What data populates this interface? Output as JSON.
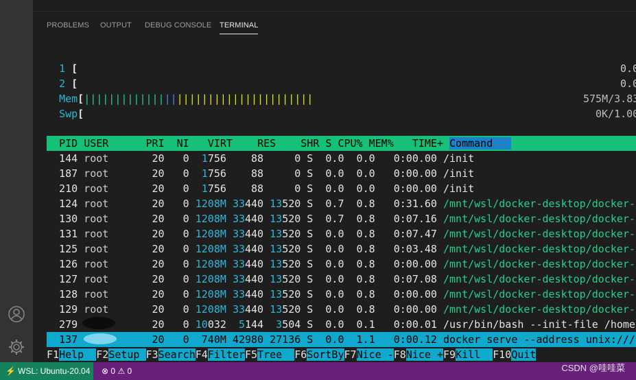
{
  "panel": {
    "tabs": [
      {
        "label": "PROBLEMS",
        "active": false
      },
      {
        "label": "OUTPUT",
        "active": false
      },
      {
        "label": "DEBUG CONSOLE",
        "active": false
      },
      {
        "label": "TERMINAL",
        "active": true
      }
    ]
  },
  "htop": {
    "meters": {
      "cpu1": {
        "label": "1",
        "bracket": "[",
        "value": "0.0"
      },
      "cpu2": {
        "label": "2",
        "bracket": "[",
        "value": "0.0"
      },
      "mem": {
        "label": "Mem",
        "bracket": "[",
        "bar_green": "|||||||||||||",
        "bar_blue": "||",
        "bar_yellow": "||||||||||||||||||||||",
        "value": "575M/3.83"
      },
      "swp": {
        "label": "Swp",
        "bracket": "[",
        "value": "0K/1.00"
      }
    },
    "columns": [
      "PID",
      "USER",
      "PRI",
      "NI",
      "VIRT",
      "RES",
      "SHR",
      "S",
      "CPU%",
      "MEM%",
      "TIME+",
      "Command"
    ],
    "sorted_column": "Command",
    "processes": [
      {
        "pid": "144",
        "user": "root",
        "pri": "20",
        "ni": "0",
        "virt": "1756",
        "res": "88",
        "shr": "0",
        "s": "S",
        "cpu": "0.0",
        "mem": "0.0",
        "time": "0:00.00",
        "command": "/init"
      },
      {
        "pid": "187",
        "user": "root",
        "pri": "20",
        "ni": "0",
        "virt": "1756",
        "res": "88",
        "shr": "0",
        "s": "S",
        "cpu": "0.0",
        "mem": "0.0",
        "time": "0:00.00",
        "command": "/init"
      },
      {
        "pid": "210",
        "user": "root",
        "pri": "20",
        "ni": "0",
        "virt": "1756",
        "res": "88",
        "shr": "0",
        "s": "S",
        "cpu": "0.0",
        "mem": "0.0",
        "time": "0:00.00",
        "command": "/init"
      },
      {
        "pid": "124",
        "user": "root",
        "pri": "20",
        "ni": "0",
        "virt": "1208M",
        "res": "33440",
        "shr": "13520",
        "s": "S",
        "cpu": "0.7",
        "mem": "0.8",
        "time": "0:31.60",
        "command": "/mnt/wsl/docker-desktop/docker-de"
      },
      {
        "pid": "130",
        "user": "root",
        "pri": "20",
        "ni": "0",
        "virt": "1208M",
        "res": "33440",
        "shr": "13520",
        "s": "S",
        "cpu": "0.7",
        "mem": "0.8",
        "time": "0:07.16",
        "command": "/mnt/wsl/docker-desktop/docker-de"
      },
      {
        "pid": "131",
        "user": "root",
        "pri": "20",
        "ni": "0",
        "virt": "1208M",
        "res": "33440",
        "shr": "13520",
        "s": "S",
        "cpu": "0.0",
        "mem": "0.8",
        "time": "0:07.47",
        "command": "/mnt/wsl/docker-desktop/docker-de"
      },
      {
        "pid": "125",
        "user": "root",
        "pri": "20",
        "ni": "0",
        "virt": "1208M",
        "res": "33440",
        "shr": "13520",
        "s": "S",
        "cpu": "0.0",
        "mem": "0.8",
        "time": "0:03.48",
        "command": "/mnt/wsl/docker-desktop/docker-de"
      },
      {
        "pid": "126",
        "user": "root",
        "pri": "20",
        "ni": "0",
        "virt": "1208M",
        "res": "33440",
        "shr": "13520",
        "s": "S",
        "cpu": "0.0",
        "mem": "0.8",
        "time": "0:00.00",
        "command": "/mnt/wsl/docker-desktop/docker-de"
      },
      {
        "pid": "127",
        "user": "root",
        "pri": "20",
        "ni": "0",
        "virt": "1208M",
        "res": "33440",
        "shr": "13520",
        "s": "S",
        "cpu": "0.0",
        "mem": "0.8",
        "time": "0:07.08",
        "command": "/mnt/wsl/docker-desktop/docker-de"
      },
      {
        "pid": "128",
        "user": "root",
        "pri": "20",
        "ni": "0",
        "virt": "1208M",
        "res": "33440",
        "shr": "13520",
        "s": "S",
        "cpu": "0.0",
        "mem": "0.8",
        "time": "0:00.00",
        "command": "/mnt/wsl/docker-desktop/docker-de"
      },
      {
        "pid": "129",
        "user": "root",
        "pri": "20",
        "ni": "0",
        "virt": "1208M",
        "res": "33440",
        "shr": "13520",
        "s": "S",
        "cpu": "0.0",
        "mem": "0.8",
        "time": "0:00.00",
        "command": "/mnt/wsl/docker-desktop/docker-de"
      },
      {
        "pid": "279",
        "user": "",
        "pri": "20",
        "ni": "0",
        "virt": "10032",
        "res": "5144",
        "shr": "3504",
        "s": "S",
        "cpu": "0.0",
        "mem": "0.1",
        "time": "0:00.01",
        "command": "/usr/bin/bash --init-file /home/c"
      }
    ],
    "selected_process": {
      "pid": "137",
      "user": "",
      "pri": "20",
      "ni": "0",
      "virt": "740M",
      "res": "42980",
      "shr": "27136",
      "s": "S",
      "cpu": "0.0",
      "mem": "1.1",
      "time": "0:00.12",
      "command": "docker serve --address unix:///ho"
    },
    "function_keys": [
      {
        "key": "F1",
        "label": "Help  "
      },
      {
        "key": "F2",
        "label": "Setup "
      },
      {
        "key": "F3",
        "label": "Search"
      },
      {
        "key": "F4",
        "label": "Filter"
      },
      {
        "key": "F5",
        "label": "Tree  "
      },
      {
        "key": "F6",
        "label": "SortBy"
      },
      {
        "key": "F7",
        "label": "Nice -"
      },
      {
        "key": "F8",
        "label": "Nice +"
      },
      {
        "key": "F9",
        "label": "Kill  "
      },
      {
        "key": "F10",
        "label": "Quit"
      }
    ]
  },
  "statusbar": {
    "remote_label": "WSL: Ubuntu-20.04",
    "errors": "0",
    "warnings": "0"
  },
  "watermark": "CSDN @哇哇菜",
  "colors": {
    "header_bg": "#16c079",
    "selected_bg": "#11a8cd",
    "statusbar_bg": "#68217a",
    "remote_bg": "#16825d"
  }
}
